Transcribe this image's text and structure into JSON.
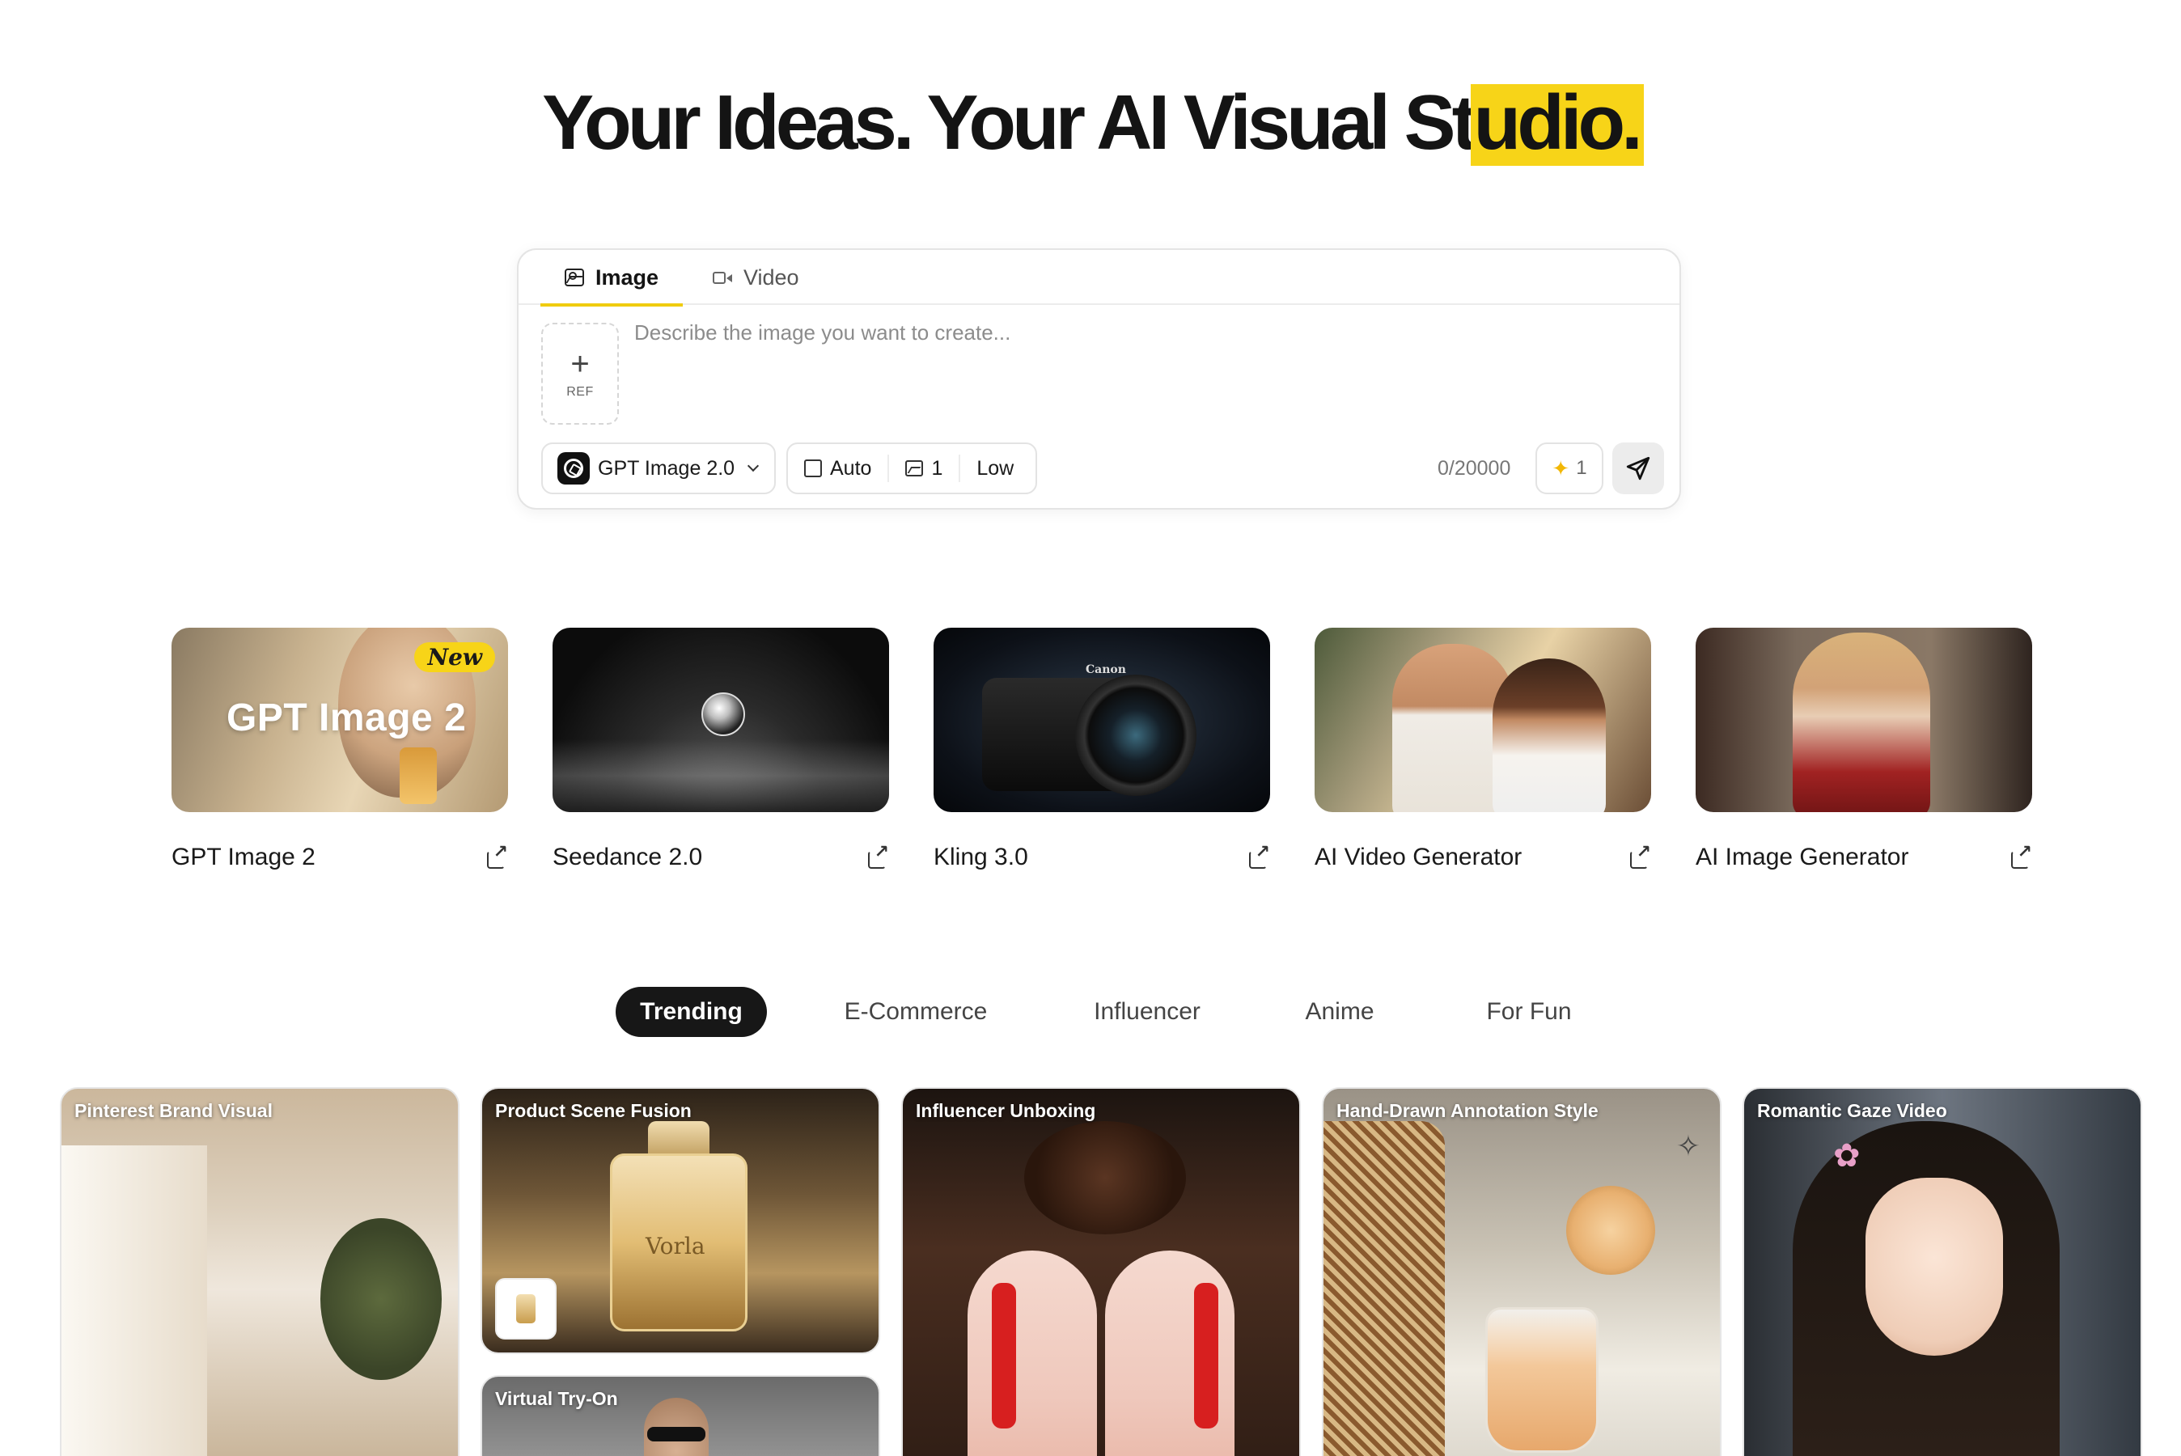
{
  "hero": {
    "title_part1": "Your Ideas. Your AI Visual St",
    "title_highlight": "udio."
  },
  "prompt_box": {
    "tabs": [
      {
        "label": "Image",
        "icon": "image-icon",
        "active": true
      },
      {
        "label": "Video",
        "icon": "video-icon",
        "active": false
      }
    ],
    "ref_label": "REF",
    "placeholder": "Describe the image you want to create...",
    "model": "GPT Image 2.0",
    "aspect": "Auto",
    "count": "1",
    "quality": "Low",
    "char_counter": "0/20000",
    "credits": "1",
    "accent_color": "#f7d418"
  },
  "tools": [
    {
      "name": "GPT Image 2",
      "thumb_text": "GPT Image 2",
      "badge": "New"
    },
    {
      "name": "Seedance 2.0"
    },
    {
      "name": "Kling 3.0",
      "brand_text": "Canon"
    },
    {
      "name": "AI Video Generator"
    },
    {
      "name": "AI Image Generator"
    }
  ],
  "categories": [
    {
      "label": "Trending",
      "active": true
    },
    {
      "label": "E-Commerce",
      "active": false
    },
    {
      "label": "Influencer",
      "active": false
    },
    {
      "label": "Anime",
      "active": false
    },
    {
      "label": "For Fun",
      "active": false
    }
  ],
  "gallery": [
    {
      "label": "Pinterest Brand Visual"
    },
    {
      "label": "Product Scene Fusion",
      "product_text": "Vorla"
    },
    {
      "label": "Virtual Try-On"
    },
    {
      "label": "Influencer Unboxing"
    },
    {
      "label": "Hand-Drawn Annotation Style"
    },
    {
      "label": "Romantic Gaze Video"
    }
  ]
}
